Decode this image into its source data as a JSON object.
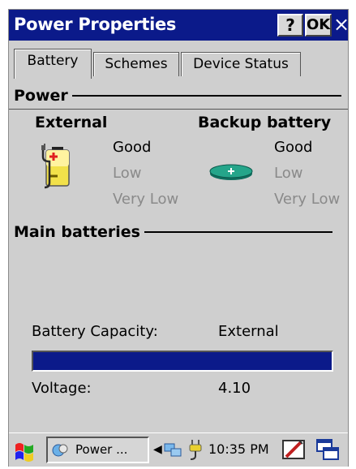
{
  "window": {
    "title": "Power Properties",
    "help_label": "?",
    "ok_label": "OK",
    "close_label": "×"
  },
  "tabs": [
    {
      "label": "Battery",
      "active": true
    },
    {
      "label": "Schemes",
      "active": false
    },
    {
      "label": "Device Status",
      "active": false
    }
  ],
  "power": {
    "heading": "Power",
    "external": {
      "label": "External",
      "icon": "external-power-icon",
      "levels": [
        "Good",
        "Low",
        "Very Low"
      ]
    },
    "backup": {
      "label": "Backup battery",
      "icon": "coin-cell-battery-icon",
      "levels": [
        "Good",
        "Low",
        "Very Low"
      ]
    }
  },
  "main_batteries": {
    "heading": "Main batteries",
    "capacity_label": "Battery Capacity:",
    "capacity_value": "External",
    "progress_percent": 100,
    "voltage_label": "Voltage:",
    "voltage_value": "4.10"
  },
  "taskbar": {
    "task_label": "Power ...",
    "clock": "10:35 PM"
  },
  "colors": {
    "title_bar": "#0b1a8a",
    "window_bg": "#cfcfcf",
    "progress_fill": "#0b1a8a",
    "dim_text": "#8a8a8a"
  }
}
